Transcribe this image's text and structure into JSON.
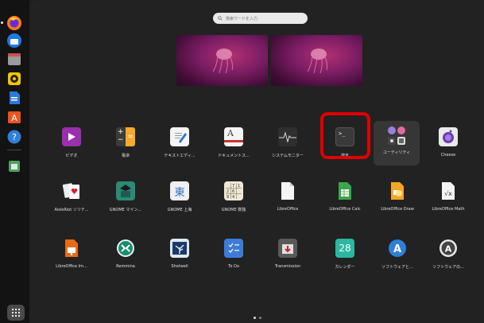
{
  "search": {
    "placeholder": "検索ワードを入力"
  },
  "dock": {
    "items": [
      {
        "name": "firefox-icon"
      },
      {
        "name": "thunderbird-icon"
      },
      {
        "name": "files-icon"
      },
      {
        "name": "rhythmbox-icon"
      },
      {
        "name": "writer-icon"
      },
      {
        "name": "software-icon"
      },
      {
        "name": "help-icon"
      },
      {
        "name": "trash-icon"
      }
    ]
  },
  "apps": {
    "row1": [
      "ビデオ",
      "電卓",
      "テキストエディ...",
      "ドキュメントス...",
      "システムモニター",
      "端末",
      "ユーティリティ",
      "Cheese"
    ],
    "row2": [
      "AisleRiot ソリテ...",
      "GNOME マイン...",
      "GNOME 上海",
      "GNOME 数独",
      "LibreOffice",
      "LibreOffice Calc",
      "LibreOffice Draw",
      "LibreOffice Math"
    ],
    "row3": [
      "LibreOffice Im...",
      "Remmina",
      "Shotwell",
      "To Do",
      "Transmission",
      "カレンダー",
      "ソフトウェアと...",
      "ソフトウェアの..."
    ]
  },
  "glyphs": {
    "calculator_plus": "+",
    "calculator_minus": "−",
    "calculator_eq": "=",
    "document_a": "A",
    "terminal_prompt": ">_",
    "mahjong_char": "東",
    "sudoku_grid": "7 1\n2 6\n9 4",
    "calendar_day": "28",
    "math_formula": "√x"
  },
  "colors": {
    "highlight": "#e00000",
    "background": "#222222",
    "dock": "#131313"
  }
}
